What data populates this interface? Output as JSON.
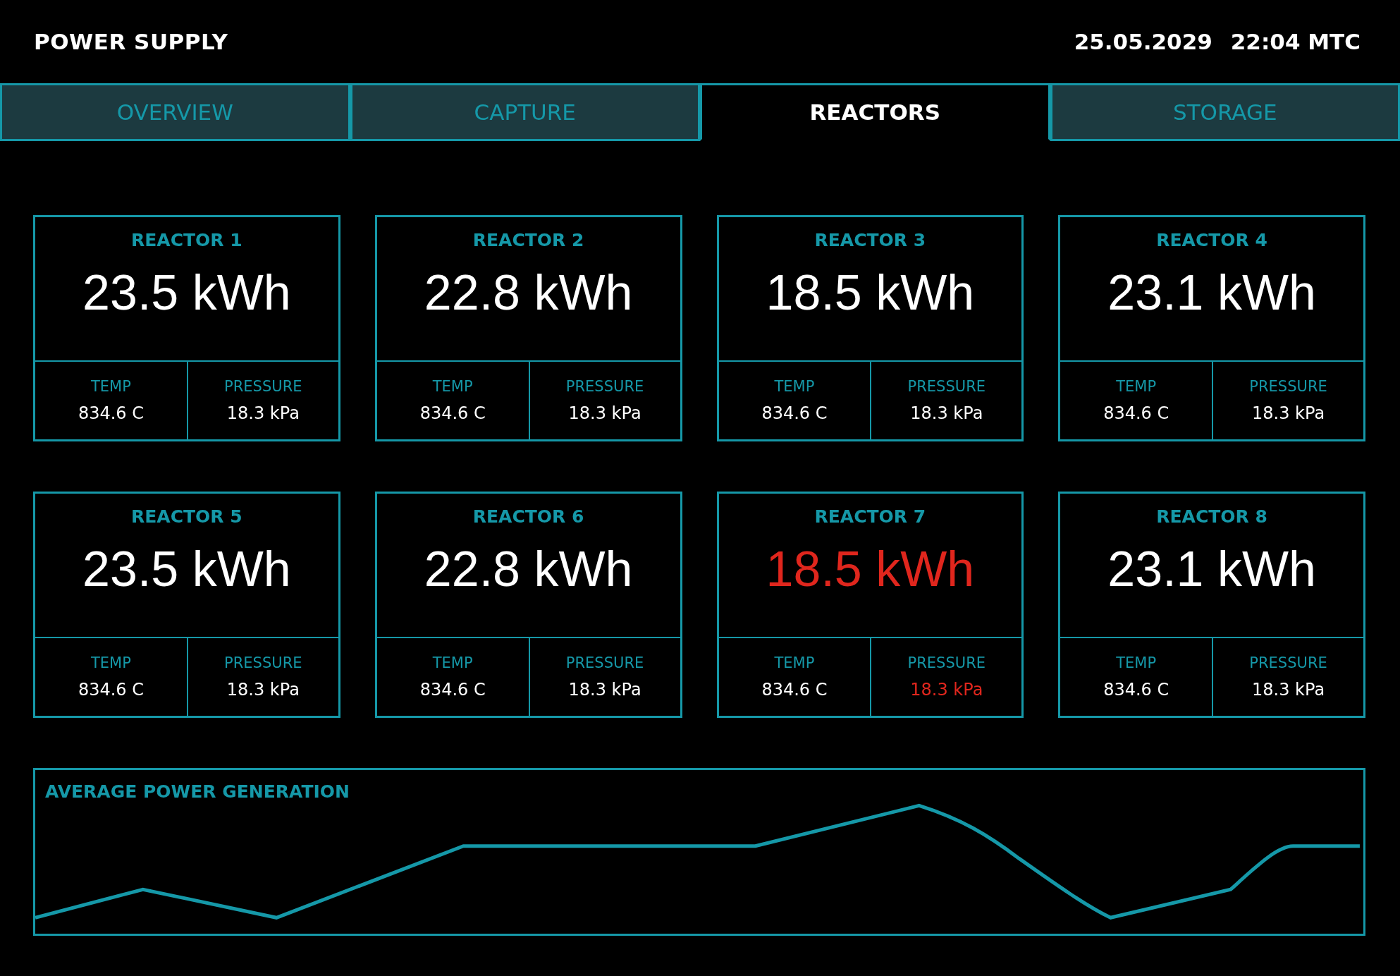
{
  "header": {
    "title": "POWER SUPPLY",
    "date": "25.05.2029",
    "time": "22:04 MTC"
  },
  "tabs": [
    {
      "label": "OVERVIEW",
      "selected": false
    },
    {
      "label": "CAPTURE",
      "selected": false
    },
    {
      "label": "REACTORS",
      "selected": true
    },
    {
      "label": "STORAGE",
      "selected": false
    }
  ],
  "reactors": [
    {
      "name": "REACTOR 1",
      "output": {
        "text": "23.5 kWh",
        "alert": false
      },
      "readings": [
        {
          "label": "TEMP",
          "value": "834.6 C",
          "alert": false
        },
        {
          "label": "PRESSURE",
          "value": "18.3 kPa",
          "alert": false
        }
      ]
    },
    {
      "name": "REACTOR 2",
      "output": {
        "text": "22.8 kWh",
        "alert": false
      },
      "readings": [
        {
          "label": "TEMP",
          "value": "834.6 C",
          "alert": false
        },
        {
          "label": "PRESSURE",
          "value": "18.3 kPa",
          "alert": false
        }
      ]
    },
    {
      "name": "REACTOR 3",
      "output": {
        "text": "18.5 kWh",
        "alert": false
      },
      "readings": [
        {
          "label": "TEMP",
          "value": "834.6 C",
          "alert": false
        },
        {
          "label": "PRESSURE",
          "value": "18.3 kPa",
          "alert": false
        }
      ]
    },
    {
      "name": "REACTOR 4",
      "output": {
        "text": "23.1 kWh",
        "alert": false
      },
      "readings": [
        {
          "label": "TEMP",
          "value": "834.6 C",
          "alert": false
        },
        {
          "label": "PRESSURE",
          "value": "18.3 kPa",
          "alert": false
        }
      ]
    },
    {
      "name": "REACTOR 5",
      "output": {
        "text": "23.5 kWh",
        "alert": false
      },
      "readings": [
        {
          "label": "TEMP",
          "value": "834.6 C",
          "alert": false
        },
        {
          "label": "PRESSURE",
          "value": "18.3 kPa",
          "alert": false
        }
      ]
    },
    {
      "name": "REACTOR 6",
      "output": {
        "text": "22.8 kWh",
        "alert": false
      },
      "readings": [
        {
          "label": "TEMP",
          "value": "834.6 C",
          "alert": false
        },
        {
          "label": "PRESSURE",
          "value": "18.3 kPa",
          "alert": false
        }
      ]
    },
    {
      "name": "REACTOR 7",
      "output": {
        "text": "18.5 kWh",
        "alert": true
      },
      "readings": [
        {
          "label": "TEMP",
          "value": "834.6 C",
          "alert": false
        },
        {
          "label": "PRESSURE",
          "value": "18.3 kPa",
          "alert": true
        }
      ]
    },
    {
      "name": "REACTOR 8",
      "output": {
        "text": "23.1 kWh",
        "alert": false
      },
      "readings": [
        {
          "label": "TEMP",
          "value": "834.6 C",
          "alert": false
        },
        {
          "label": "PRESSURE",
          "value": "18.3 kPa",
          "alert": false
        }
      ]
    }
  ],
  "power_panel": {
    "title": "AVERAGE POWER GENERATION"
  }
}
